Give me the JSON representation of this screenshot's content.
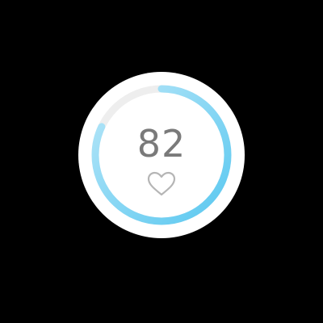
{
  "widget": {
    "value": "82",
    "progress_fraction": 0.82,
    "icon": "heart-icon",
    "colors": {
      "face": "#ffffff",
      "ring_track": "#eeeeee",
      "ring_progress_start": "#5ac8f0",
      "ring_progress_end": "#b7e6f8",
      "text": "#7a7a7a",
      "icon_stroke": "#b5b5b5"
    }
  }
}
